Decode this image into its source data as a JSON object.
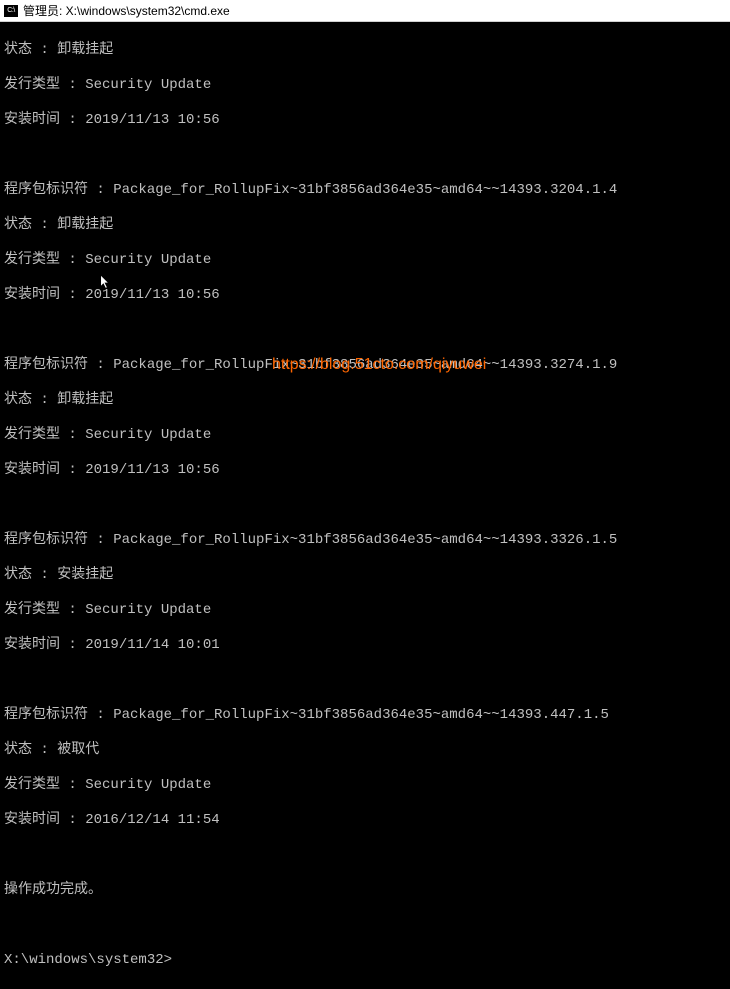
{
  "window": {
    "icon_text": "C:\\",
    "title": "管理员: X:\\windows\\system32\\cmd.exe"
  },
  "labels": {
    "status": "状态",
    "release_type": "发行类型",
    "install_time": "安装时间",
    "package_id": "程序包标识符"
  },
  "blocks": [
    {
      "status": "卸载挂起",
      "release_type": "Security Update",
      "install_time": "2019/11/13 10:56"
    },
    {
      "package_id": "Package_for_RollupFix~31bf3856ad364e35~amd64~~14393.3204.1.4",
      "status": "卸载挂起",
      "release_type": "Security Update",
      "install_time": "2019/11/13 10:56"
    },
    {
      "package_id": "Package_for_RollupFix~31bf3856ad364e35~amd64~~14393.3274.1.9",
      "status": "卸载挂起",
      "release_type": "Security Update",
      "install_time": "2019/11/13 10:56"
    },
    {
      "package_id": "Package_for_RollupFix~31bf3856ad364e35~amd64~~14393.3326.1.5",
      "status": "安装挂起",
      "release_type": "Security Update",
      "install_time": "2019/11/14 10:01"
    },
    {
      "package_id": "Package_for_RollupFix~31bf3856ad364e35~amd64~~14393.447.1.5",
      "status": "被取代",
      "release_type": "Security Update",
      "install_time": "2016/12/14 11:54"
    }
  ],
  "footer": {
    "success": "操作成功完成。",
    "prompt": "X:\\windows\\system32>"
  },
  "watermark": "https://blog.51cto.com/qiyuwei"
}
